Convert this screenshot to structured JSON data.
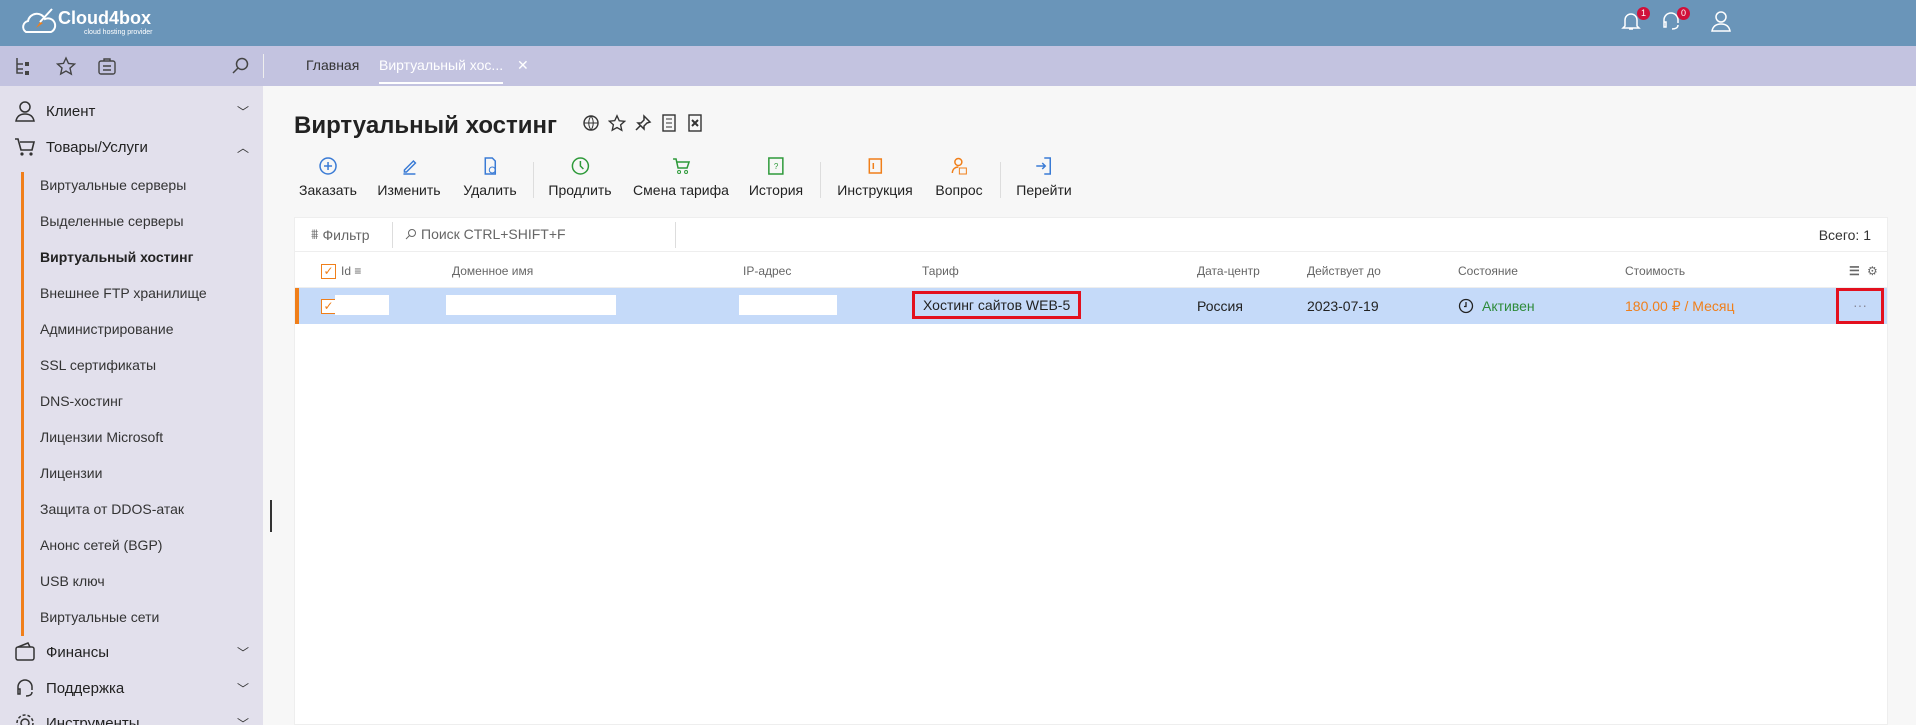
{
  "app": {
    "brand": "Cloud4box",
    "tagline": "cloud hosting provider",
    "notifications_count": "1",
    "support_count": "0"
  },
  "tabs": [
    {
      "label": "Главная"
    },
    {
      "label": "Виртуальный хос..."
    }
  ],
  "sidebar": {
    "sections": [
      {
        "label": "Клиент"
      },
      {
        "label": "Товары/Услуги"
      },
      {
        "label": "Финансы"
      },
      {
        "label": "Поддержка"
      },
      {
        "label": "Инструменты"
      }
    ],
    "items": [
      {
        "label": "Виртуальные серверы"
      },
      {
        "label": "Выделенные серверы"
      },
      {
        "label": "Виртуальный хостинг"
      },
      {
        "label": "Внешнее FTP хранилище"
      },
      {
        "label": "Администрирование"
      },
      {
        "label": "SSL сертификаты"
      },
      {
        "label": "DNS-хостинг"
      },
      {
        "label": "Лицензии Microsoft"
      },
      {
        "label": "Лицензии"
      },
      {
        "label": "Защита от DDOS-атак"
      },
      {
        "label": "Анонс сетей (BGP)"
      },
      {
        "label": "USB ключ"
      },
      {
        "label": "Виртуальные сети"
      }
    ]
  },
  "page": {
    "title": "Виртуальный хостинг"
  },
  "toolbar": [
    "Заказать",
    "Изменить",
    "Удалить",
    "Продлить",
    "Смена тарифа",
    "История",
    "Инструкция",
    "Вопрос",
    "Перейти"
  ],
  "table": {
    "filter_label": "Фильтр",
    "search_placeholder": "Поиск CTRL+SHIFT+F",
    "total": "Всего: 1",
    "columns": [
      "Id",
      "Доменное имя",
      "IP-адрес",
      "Тариф",
      "Дата-центр",
      "Действует до",
      "Состояние",
      "Стоимость"
    ],
    "rows": [
      {
        "tariff": "Хостинг сайтов WEB-5",
        "datacenter": "Россия",
        "valid_until": "2023-07-19",
        "status": "Активен",
        "cost": "180.00 ₽ / Месяц",
        "more": "···"
      }
    ]
  },
  "colors": {
    "header": "#6a95b9",
    "tabbar": "#c3c3e0",
    "accent": "#f07f1a",
    "row_selected": "#c5daf9",
    "status_active": "#2e8b3a",
    "highlight": "#e3101e"
  }
}
